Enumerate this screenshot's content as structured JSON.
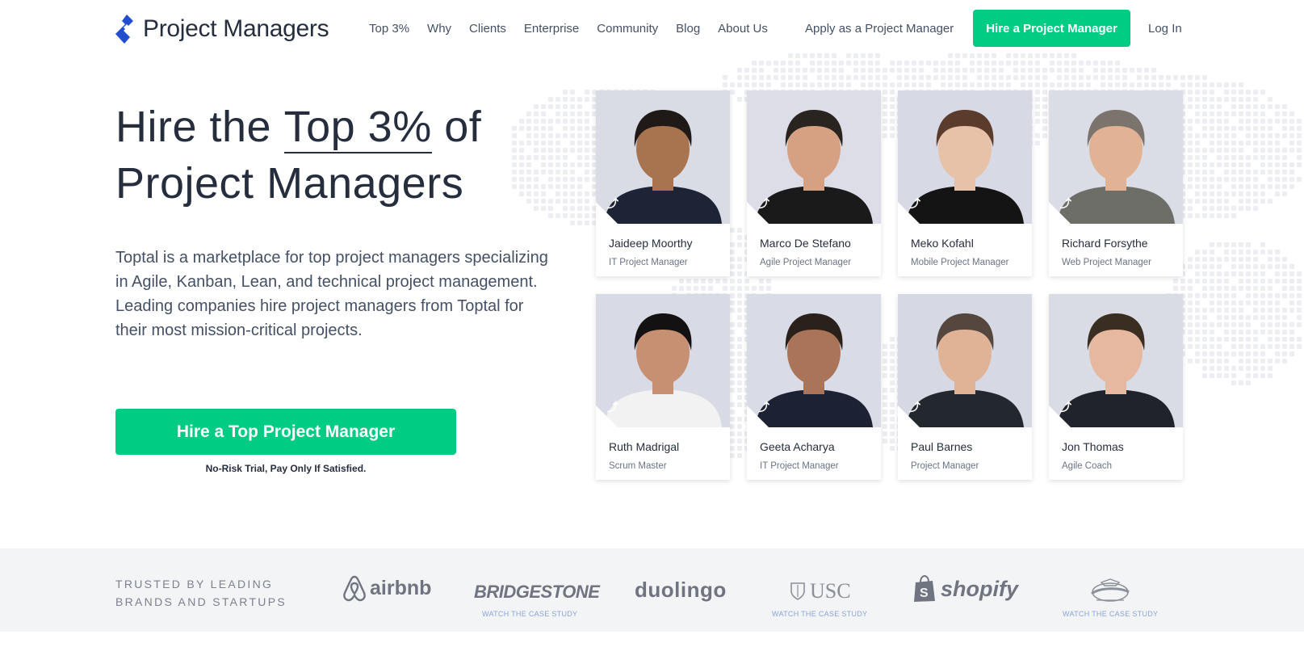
{
  "nav": {
    "logo_text": "Project Managers",
    "links": [
      "Top 3%",
      "Why",
      "Clients",
      "Enterprise",
      "Community",
      "Blog",
      "About Us"
    ],
    "apply": "Apply as a Project Manager",
    "hire": "Hire a Project Manager",
    "login": "Log In"
  },
  "hero": {
    "title_pre": "Hire the ",
    "title_highlight": "Top 3%",
    "title_post": " of",
    "title_line2": "Project Managers",
    "desc_line1": "Toptal is a marketplace for top project managers specializing in Agile, Kanban, Lean, and technical project management.",
    "desc_line2": "Leading companies hire project managers from Toptal for their most mission-critical projects.",
    "cta": "Hire a Top Project Manager",
    "note": "No-Risk Trial, Pay Only If Satisfied."
  },
  "colors": {
    "accent": "#00cc83",
    "logo": "#204ecf",
    "text": "#262d3d"
  },
  "talent": [
    {
      "name": "Jaideep Moorthy",
      "role": "IT Project Manager"
    },
    {
      "name": "Marco De Stefano",
      "role": "Agile Project Manager"
    },
    {
      "name": "Meko Kofahl",
      "role": "Mobile Project Manager"
    },
    {
      "name": "Richard Forsythe",
      "role": "Web Project Manager"
    },
    {
      "name": "Ruth Madrigal",
      "role": "Scrum Master"
    },
    {
      "name": "Geeta Acharya",
      "role": "IT Project Manager"
    },
    {
      "name": "Paul Barnes",
      "role": "Project Manager"
    },
    {
      "name": "Jon Thomas",
      "role": "Agile Coach"
    }
  ],
  "brands": {
    "trusted_line1": "TRUSTED BY LEADING",
    "trusted_line2": "BRANDS AND STARTUPS",
    "airbnb": "airbnb",
    "bridgestone": "BRIDGESTONE",
    "duolingo": "duolingo",
    "usc": "USC",
    "shopify": "shopify",
    "case_study": "WATCH THE CASE STUDY"
  }
}
